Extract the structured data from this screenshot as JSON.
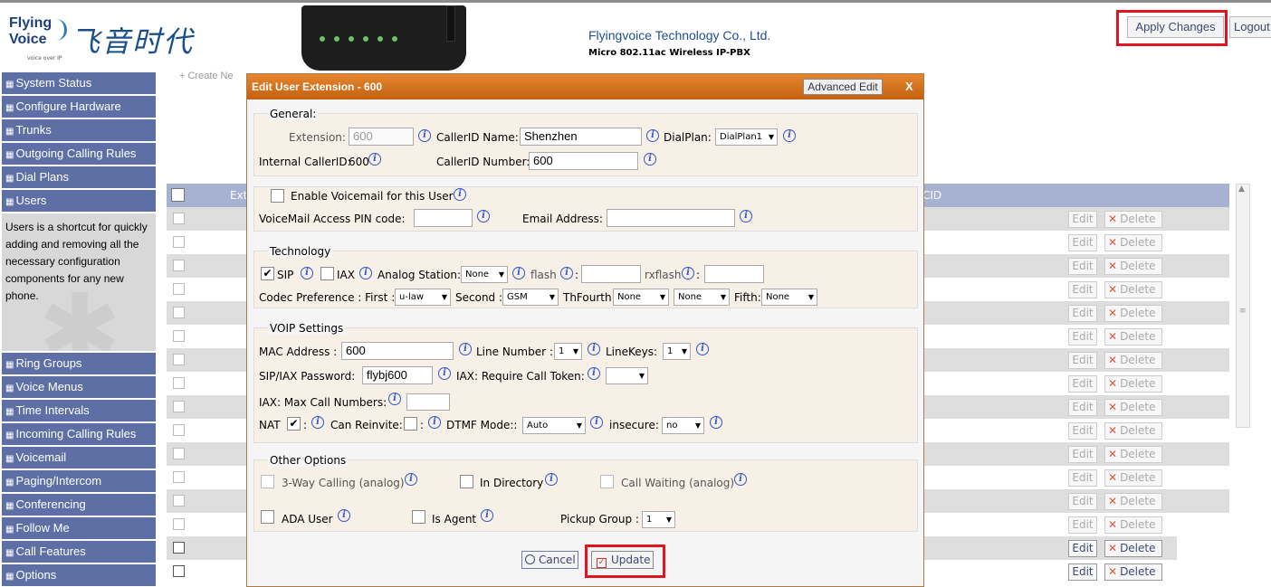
{
  "header": {
    "logo_en_line1": "Flying",
    "logo_en_line2": "Voice",
    "logo_tagline": "voice over IP",
    "logo_cn": "飞音时代",
    "company": "Flyingvoice Technology Co., Ltd.",
    "product": "Micro 802.11ac Wireless IP-PBX",
    "apply_label": "Apply Changes",
    "logout_label": "Logout"
  },
  "sidebar": {
    "items_top": [
      {
        "label": "System Status"
      },
      {
        "label": "Configure Hardware"
      },
      {
        "label": "Trunks"
      },
      {
        "label": "Outgoing Calling Rules"
      },
      {
        "label": "Dial Plans"
      },
      {
        "label": "Users"
      }
    ],
    "help_text": "Users is a shortcut for quickly adding and removing all the necessary configuration components for any new phone.",
    "items_bottom": [
      {
        "label": "Ring Groups"
      },
      {
        "label": "Voice Menus"
      },
      {
        "label": "Time Intervals"
      },
      {
        "label": "Incoming Calling Rules"
      },
      {
        "label": "Voicemail"
      },
      {
        "label": "Paging/Intercom"
      },
      {
        "label": "Conferencing"
      },
      {
        "label": "Follow Me"
      },
      {
        "label": "Call Features"
      },
      {
        "label": "Options"
      }
    ]
  },
  "table": {
    "create_label": "Create Ne",
    "header_ext": "Ext",
    "header_cid": "CID",
    "edit_label": "Edit",
    "delete_label": "Delete"
  },
  "modal": {
    "title": "Edit User Extension - 600",
    "advanced_edit": "Advanced Edit",
    "close": "X",
    "general": {
      "legend": "General:",
      "extension_label": "Extension:",
      "extension_value": "600",
      "callerid_name_label": "CallerID Name:",
      "callerid_name_value": "Shenzhen",
      "dialplan_label": "DialPlan:",
      "dialplan_value": "DialPlan1",
      "internal_callerid_label": "Internal CallerID:",
      "internal_callerid_value": "600",
      "callerid_number_label": "CallerID Number:",
      "callerid_number_value": "600"
    },
    "voicemail": {
      "enable_label": "Enable Voicemail for this User",
      "pin_label": "VoiceMail Access PIN code:",
      "email_label": "Email Address:"
    },
    "technology": {
      "legend": "Technology",
      "sip_label": "SIP",
      "iax_label": "IAX",
      "analog_label": "Analog Station:",
      "analog_value": "None",
      "flash_label": "flash",
      "rxflash_label": "rxflash",
      "codec_label": "Codec Preference : First :",
      "codec_first": "u-law",
      "second_label": "Second :",
      "codec_second": "GSM",
      "thfourth_label": "ThFourth:",
      "codec_third": "None",
      "codec_fourth": "None",
      "fifth_label": "Fifth:",
      "codec_fifth": "None"
    },
    "voip": {
      "legend": "VOIP Settings",
      "mac_label": "MAC Address :",
      "mac_value": "600",
      "line_number_label": "Line Number :",
      "line_number_value": "1",
      "linekeys_label": "LineKeys:",
      "linekeys_value": "1",
      "password_label": "SIP/IAX Password:",
      "password_value": "flybj600",
      "require_token_label": "IAX: Require Call Token:",
      "require_token_value": "",
      "max_calls_label": "IAX: Max Call Numbers:",
      "nat_label": "NAT",
      "can_reinvite_label": "Can Reinvite:",
      "dtmf_label": "DTMF Mode::",
      "dtmf_value": "Auto",
      "insecure_label": "insecure:",
      "insecure_value": "no"
    },
    "other": {
      "legend": "Other Options",
      "three_way_label": "3-Way Calling (analog)",
      "in_directory_label": "In Directory",
      "call_waiting_label": "Call Waiting (analog)",
      "ada_label": "ADA User",
      "is_agent_label": "Is Agent",
      "pickup_label": "Pickup Group :",
      "pickup_value": "1"
    },
    "cancel_label": "Cancel",
    "update_label": "Update"
  },
  "colors": {
    "sidebar_bg": "#5e6fa6",
    "modal_title": "#d0701c",
    "highlight_box": "#e0161f",
    "table_header": "#a7b2d3"
  }
}
